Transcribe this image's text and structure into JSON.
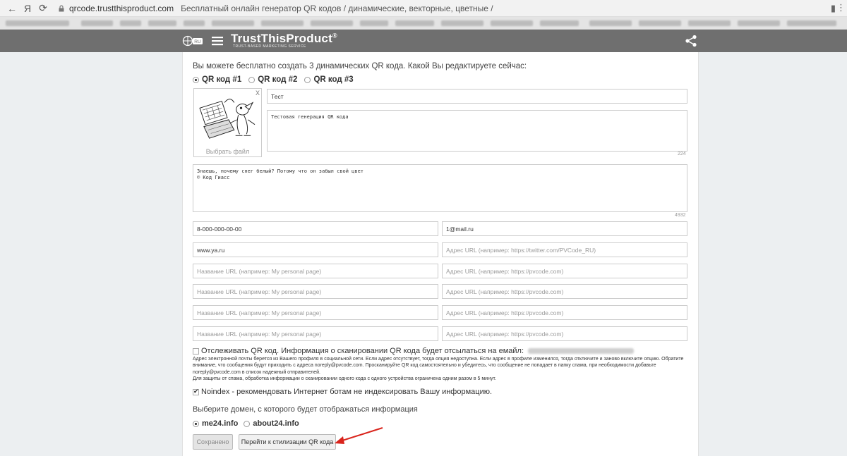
{
  "browser": {
    "back_label": "←",
    "yandex_label": "Я",
    "reload_label": "⟳",
    "domain": "qrcode.trustthisproduct.com",
    "title": "Бесплатный онлайн генератор QR кодов / динамические, векторные, цветные /"
  },
  "header": {
    "brand": "TrustThisProduct",
    "brand_mark": "®",
    "tagline": "TRUST-BASED MARKETING SERVICE",
    "globe_label": "RU"
  },
  "intro_text": "Вы можете бесплатно создать 3 динамических QR кода. Какой Вы редактируете сейчас:",
  "qr_tabs": [
    {
      "label": "QR код #1",
      "selected": true
    },
    {
      "label": "QR код #2",
      "selected": false
    },
    {
      "label": "QR код #3",
      "selected": false
    }
  ],
  "image_box": {
    "close_label": "X",
    "pick_label": "Выбрать файл"
  },
  "name_field": {
    "value": "Тест"
  },
  "description": {
    "value": "Тестовая генерация QR кода",
    "counter": "224"
  },
  "message": {
    "value": "Знаешь, почему снег белый? Потому что он забыл свой цвет\n© Код Гиасс",
    "counter": "4932"
  },
  "fields": {
    "phone": "8-000-000-00-00",
    "email": "1@mail.ru",
    "site": "www.ya.ru",
    "social_placeholder": "Адрес URL (например: https://twitter.com/PVCode_RU)",
    "url_name_placeholder": "Название URL (например: My personal page)",
    "url_addr_placeholder": "Адрес URL (например: https://pvcode.com)"
  },
  "tracking": {
    "label": "Отслеживать QR код. Информация о сканировании QR кода будет отсылаться на емайл:",
    "note": "Адрес электронной почты берется из Вашего профиля в социальной сети. Если адрес отсутствует, тогда опция недоступна. Если адрес в профиле изменился, тогда отключите и заново включите опцию. Обратите внимание, что сообщения будут приходить с адреса noreply@pvcode.com. Просканируйте QR код самостоятельно и убедитесь, что сообщение не попадает в папку спама, при необходимости добавьте noreply@pvcode.com в список надежный отправителей.\nДля защиты от спама, обработка информации о сканировании одного кода с одного устройства ограничена одним разом в 5 минут."
  },
  "noindex": {
    "label": "Noindex - рекомендовать Интернет ботам не индексировать Вашу информацию.",
    "checked": true
  },
  "domain_choice": {
    "label": "Выберите домен, с которого будет отображаться информация",
    "options": [
      {
        "label": "me24.info",
        "selected": true
      },
      {
        "label": "about24.info",
        "selected": false
      }
    ]
  },
  "buttons": {
    "saved": "Сохранено",
    "go_styling": "Перейти к стилизации QR кода"
  },
  "colors": {
    "appbar": "#6f6f6f",
    "annotation_arrow": "#d9241c"
  }
}
